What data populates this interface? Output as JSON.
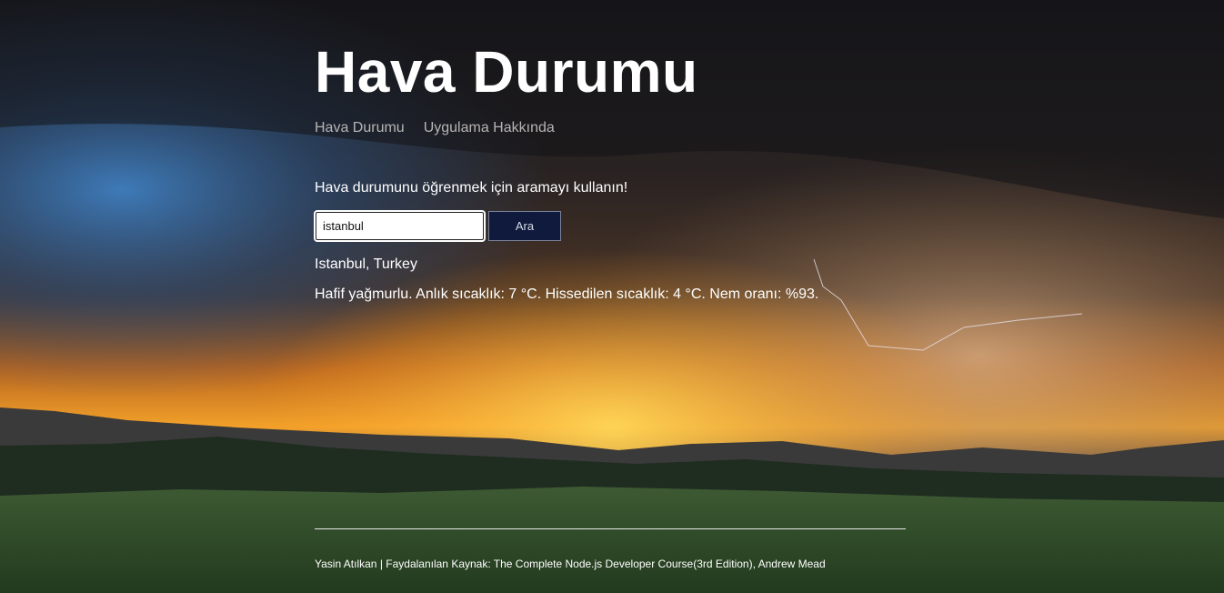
{
  "header": {
    "title": "Hava Durumu",
    "nav": [
      {
        "label": "Hava Durumu"
      },
      {
        "label": "Uygulama Hakkında"
      }
    ]
  },
  "main": {
    "prompt": "Hava durumunu öğrenmek için aramayı kullanın!",
    "search": {
      "value": "istanbul",
      "button_label": "Ara"
    },
    "result": {
      "location": "Istanbul, Turkey",
      "forecast": "Hafif yağmurlu. Anlık sıcaklık: 7 °C. Hissedilen sıcaklık: 4 °C. Nem oranı: %93."
    }
  },
  "footer": {
    "text": "Yasin Atılkan | Faydalanılan Kaynak: The Complete Node.js Developer Course(3rd Edition), Andrew Mead"
  }
}
